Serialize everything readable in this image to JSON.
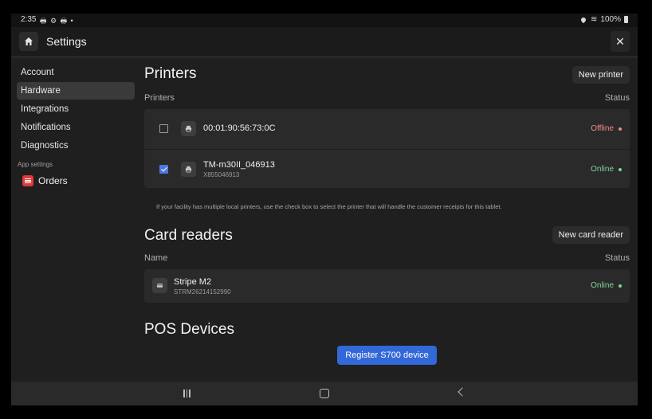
{
  "status_bar": {
    "time": "2:35",
    "notification_icons": "🖶 ⚙ 🖶 •",
    "battery": "100%"
  },
  "app_bar": {
    "title": "Settings",
    "close_glyph": "✕"
  },
  "sidebar": {
    "items": [
      {
        "label": "Account"
      },
      {
        "label": "Hardware",
        "active": true
      },
      {
        "label": "Integrations"
      },
      {
        "label": "Notifications"
      },
      {
        "label": "Diagnostics"
      }
    ],
    "group_label": "App settings",
    "app_item": {
      "label": "Orders",
      "icon": "orders-icon",
      "color": "#e03a3a"
    }
  },
  "printers": {
    "title": "Printers",
    "new_button": "New printer",
    "col_name": "Printers",
    "col_status": "Status",
    "rows": [
      {
        "name": "00:01:90:56:73:0C",
        "serial": "",
        "checked": false,
        "status": "Offline",
        "status_color": "#f08a8a"
      },
      {
        "name": "TM-m30II_046913",
        "serial": "X855046913",
        "checked": true,
        "status": "Online",
        "status_color": "#7ed69a"
      }
    ],
    "hint": "If your facility has multiple local printers, use the check box to select the printer that will handle the customer receipts for this tablet."
  },
  "card_readers": {
    "title": "Card readers",
    "new_button": "New card reader",
    "col_name": "Name",
    "col_status": "Status",
    "rows": [
      {
        "name": "Stripe M2",
        "serial": "STRM26214152990",
        "status": "Online",
        "status_color": "#7ed69a"
      }
    ]
  },
  "pos_devices": {
    "title": "POS Devices",
    "register_button": "Register S700 device"
  },
  "colors": {
    "background": "#1f1f1f",
    "card": "#2a2a2a",
    "accent": "#3268d8"
  }
}
